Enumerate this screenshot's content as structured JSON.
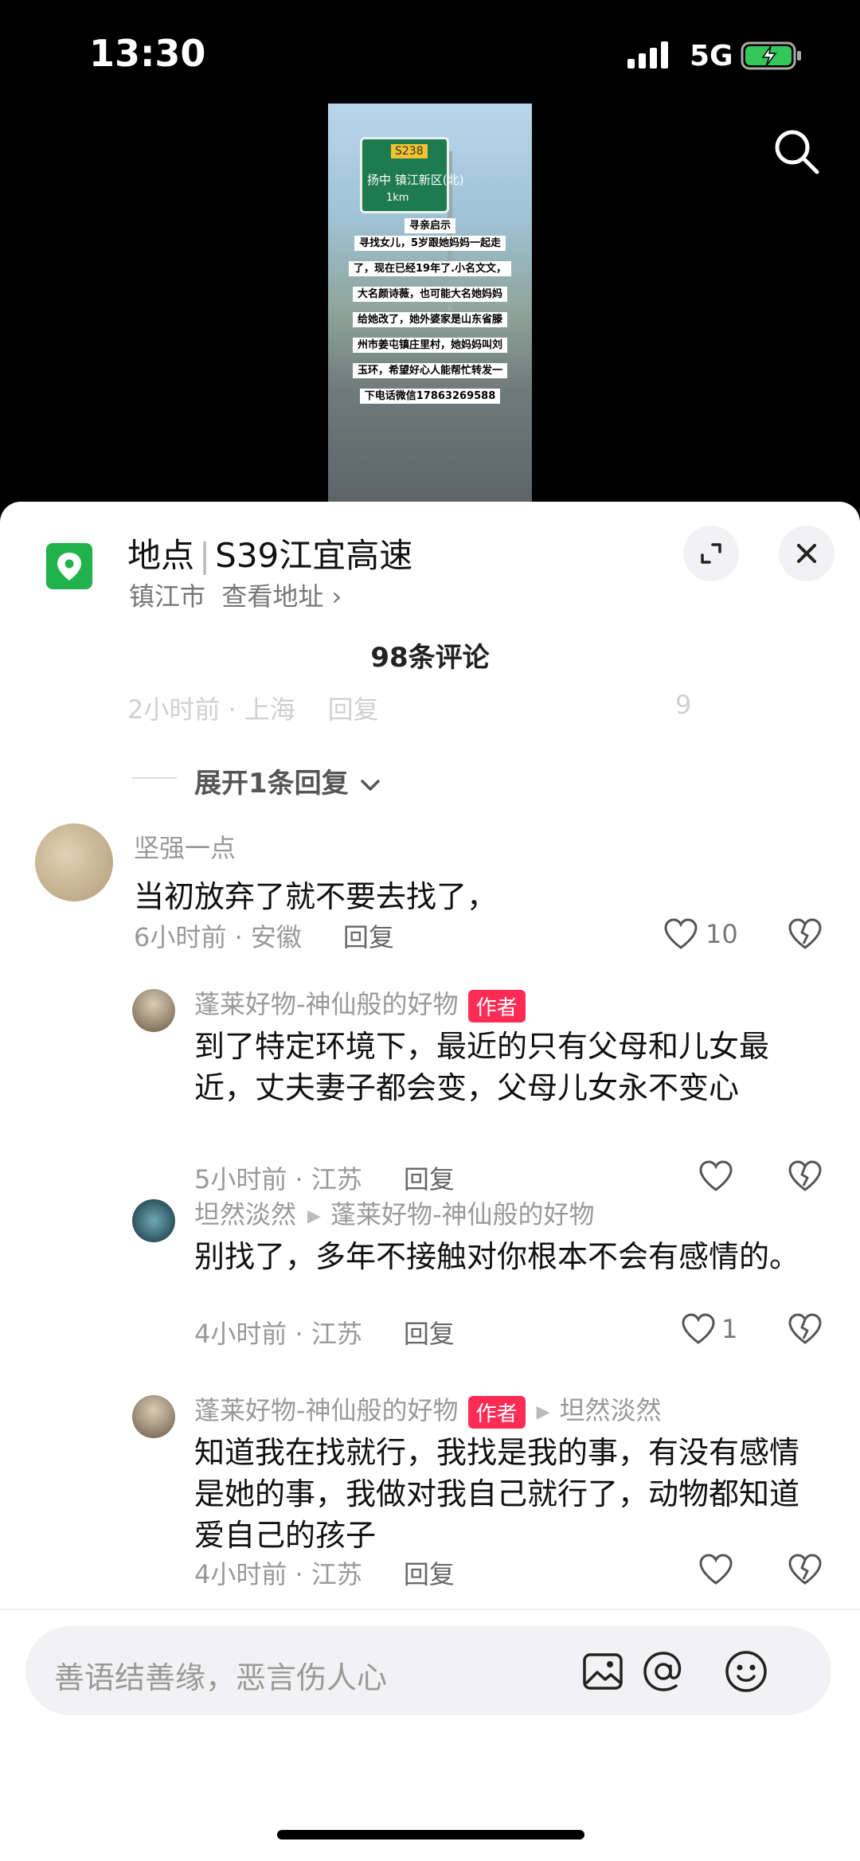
{
  "status": {
    "time": "13:30",
    "network": "5G"
  },
  "video": {
    "sign_code": "S238",
    "sign_text": "扬中 镇江新区(北)",
    "sign_distance": "1km",
    "overlay_title": "寻亲启示",
    "overlay_lines": [
      "寻找女儿，5岁跟她妈妈一起走",
      "了，现在已经19年了.小名文文，",
      "大名颜诗薇，也可能大名她妈妈",
      "给她改了，她外婆家是山东省滕",
      "州市姜屯镇庄里村，她妈妈叫刘",
      "玉环，希望好心人能帮忙转发一",
      "下电话微信17863269588"
    ]
  },
  "location": {
    "label": "地点",
    "name": "S39江宜高速",
    "city": "镇江市",
    "link": "查看地址 ›"
  },
  "comments_title": "98条评论",
  "faded_row": {
    "meta": "2小时前 · 上海",
    "reply": "回复",
    "likes": "9"
  },
  "expand_replies": "展开1条回复",
  "comments": [
    {
      "user": "坚强一点",
      "text": "当初放弃了就不要去找了，",
      "time": "6小时前 · 安徽",
      "reply": "回复",
      "likes": "10"
    }
  ],
  "replies": [
    {
      "user": "蓬莱好物-神仙般的好物",
      "badge": "作者",
      "reply_to": "",
      "text": "到了特定环境下，最近的只有父母和儿女最近，丈夫妻子都会变，父母儿女永不变心",
      "time": "5小时前 · 江苏",
      "reply": "回复",
      "likes": ""
    },
    {
      "user": "坦然淡然",
      "badge": "",
      "reply_to": "蓬莱好物-神仙般的好物",
      "text": "别找了，多年不接触对你根本不会有感情的。",
      "time": "4小时前 · 江苏",
      "reply": "回复",
      "likes": "1"
    },
    {
      "user": "蓬莱好物-神仙般的好物",
      "badge": "作者",
      "reply_to": "坦然淡然",
      "text": "知道我在找就行，我找是我的事，有没有感情是她的事，我做对我自己就行了，动物都知道爱自己的孩子",
      "time": "4小时前 · 江苏",
      "reply": "回复",
      "likes": ""
    }
  ],
  "input": {
    "placeholder": "善语结善缘，恶言伤人心"
  },
  "colors": {
    "accent": "#fe2c55",
    "location_icon": "#22b24c"
  },
  "icons": [
    "signal-icon",
    "battery-icon",
    "search-icon",
    "location-pin-icon",
    "expand-icon",
    "close-icon",
    "chevron-down-icon",
    "heart-icon",
    "dislike-heart-icon",
    "image-icon",
    "at-icon",
    "emoji-icon"
  ]
}
